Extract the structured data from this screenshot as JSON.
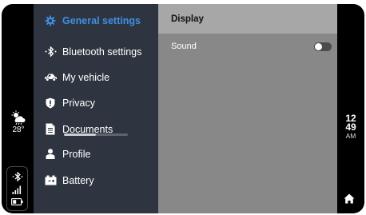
{
  "nav": {
    "items": [
      {
        "label": "General settings",
        "icon": "gear-icon",
        "active": true
      },
      {
        "label": "Bluetooth settings",
        "icon": "bluetooth-icon"
      },
      {
        "label": "My vehicle",
        "icon": "car-icon"
      },
      {
        "label": "Privacy",
        "icon": "shield-icon"
      },
      {
        "label": "Documents",
        "icon": "document-icon",
        "progress": 0.5
      },
      {
        "label": "Profile",
        "icon": "person-icon"
      },
      {
        "label": "Battery",
        "icon": "battery-case-icon"
      }
    ]
  },
  "content": {
    "header": "Display",
    "rows": [
      {
        "label": "Sound",
        "toggle": false
      }
    ]
  },
  "status": {
    "weather_icon": "partly-cloudy-rain-icon",
    "temperature": "28°",
    "bluetooth_icon": "bluetooth-icon",
    "signal_icon": "signal-bars-icon",
    "battery_icon": "battery-icon"
  },
  "clock": {
    "hour": "12",
    "minute": "49",
    "ampm": "AM"
  },
  "colors": {
    "accent": "#3f8fe6",
    "nav_bg": "#2e3541",
    "panel_bg": "#888888",
    "header_bg": "#a7a7a7",
    "frame": "#000000"
  }
}
